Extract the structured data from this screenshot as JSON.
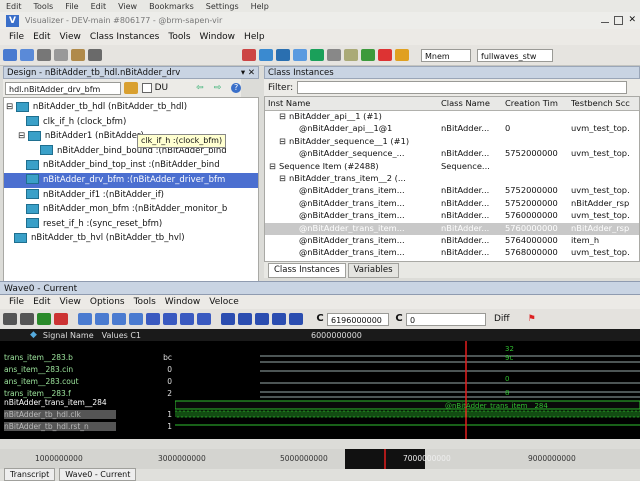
{
  "top_menu": [
    "Edit",
    "Tools",
    "File",
    "Edit",
    "View",
    "Bookmarks",
    "Settings",
    "Help"
  ],
  "window_title": "Visualizer - DEV-main #806177 - @brm-sapen-vir",
  "app_menu": [
    "File",
    "Edit",
    "View",
    "Class Instances",
    "Tools",
    "Window",
    "Help"
  ],
  "toolbar": {
    "mnem_select": "Mnem",
    "waves_select": "fullwaves_stw"
  },
  "design_panel": {
    "title": "Design - nBitAdder_tb_hdl.nBitAdder_drv",
    "scope_select": "hdl.nBitAdder_drv_bfm",
    "du_label": "DU",
    "tree": [
      {
        "label": "nBitAdder_tb_hdl (nBitAdder_tb_hdl)",
        "indent": 0,
        "selected": false
      },
      {
        "label": "clk_if_h (clock_bfm)",
        "indent": 1,
        "selected": false
      },
      {
        "label": "nBitAdder1 (nBitAdder)",
        "indent": 1,
        "selected": false
      },
      {
        "label": "nBitAdder_bind_bound :(nBitAdder_bind",
        "indent": 2,
        "selected": false
      },
      {
        "label": "nBitAdder_bind_top_inst :(nBitAdder_bind",
        "indent": 1,
        "selected": false
      },
      {
        "label": "nBitAdder_drv_bfm :(nBitAdder_driver_bfm",
        "indent": 1,
        "selected": true
      },
      {
        "label": "nBitAdder_if1 :(nBitAdder_if)",
        "indent": 1,
        "selected": false
      },
      {
        "label": "nBitAdder_mon_bfm :(nBitAdder_monitor_b",
        "indent": 1,
        "selected": false
      },
      {
        "label": "reset_if_h :(sync_reset_bfm)",
        "indent": 1,
        "selected": false
      },
      {
        "label": "nBitAdder_tb_hvl (nBitAdder_tb_hvl)",
        "indent": 0,
        "selected": false
      }
    ],
    "tooltip": "clk_if_h :(clock_bfm)"
  },
  "class_panel": {
    "title": "Class Instances",
    "filter_label": "Filter:",
    "columns": [
      "Inst Name",
      "Class Name",
      "Creation Tim",
      "Testbench Scc"
    ],
    "rows": [
      {
        "name": "nBitAdder_api__1 (#1)",
        "cls": "",
        "time": "",
        "scope": "",
        "indent": 1,
        "sel": false
      },
      {
        "name": "@nBitAdder_api__1@1",
        "cls": "nBitAdder...",
        "time": "0",
        "scope": "uvm_test_top.",
        "indent": 2,
        "sel": false
      },
      {
        "name": "nBitAdder_sequence__1 (#1)",
        "cls": "",
        "time": "",
        "scope": "",
        "indent": 1,
        "sel": false
      },
      {
        "name": "@nBitAdder_sequence_...",
        "cls": "nBitAdder...",
        "time": "5752000000",
        "scope": "uvm_test_top.",
        "indent": 2,
        "sel": false
      },
      {
        "name": "Sequence Item (#2488)",
        "cls": "Sequence...",
        "time": "",
        "scope": "",
        "indent": 0,
        "sel": false
      },
      {
        "name": "nBitAdder_trans_item__2 (...",
        "cls": "",
        "time": "",
        "scope": "",
        "indent": 1,
        "sel": false
      },
      {
        "name": "@nBitAdder_trans_item...",
        "cls": "nBitAdder...",
        "time": "5752000000",
        "scope": "uvm_test_top.",
        "indent": 2,
        "sel": false
      },
      {
        "name": "@nBitAdder_trans_item...",
        "cls": "nBitAdder...",
        "time": "5752000000",
        "scope": "nBitAdder_rsp",
        "indent": 2,
        "sel": false
      },
      {
        "name": "@nBitAdder_trans_item...",
        "cls": "nBitAdder...",
        "time": "5760000000",
        "scope": "uvm_test_top.",
        "indent": 2,
        "sel": false
      },
      {
        "name": "@nBitAdder_trans_item...",
        "cls": "nBitAdder...",
        "time": "5760000000",
        "scope": "nBitAdder_rsp",
        "indent": 2,
        "sel": true
      },
      {
        "name": "@nBitAdder_trans_item...",
        "cls": "nBitAdder...",
        "time": "5764000000",
        "scope": "item_h",
        "indent": 2,
        "sel": false
      },
      {
        "name": "@nBitAdder_trans_item...",
        "cls": "nBitAdder...",
        "time": "5768000000",
        "scope": "uvm_test_top.",
        "indent": 2,
        "sel": false
      }
    ],
    "tabs": [
      "Class Instances",
      "Variables"
    ]
  },
  "wave": {
    "title": "Wave0 - Current",
    "menu": [
      "File",
      "Edit",
      "View",
      "Options",
      "Tools",
      "Window",
      "Veloce"
    ],
    "time_field": "6196000000",
    "cursor_field": "0",
    "diff_label": "Diff",
    "col_signal": "Signal Name",
    "col_values": "Values C1",
    "ruler_top": "6000000000",
    "signals": [
      {
        "name": "trans_item__283.b",
        "value": "bc"
      },
      {
        "name": "ans_item__283.cin",
        "value": "0"
      },
      {
        "name": "ans_item__283.cout",
        "value": "0"
      },
      {
        "name": "trans_item__283.f",
        "value": "2"
      },
      {
        "name": "nBitAdder_trans_item__284",
        "value": ""
      },
      {
        "name": "nBitAdder_tb_hdl.clk",
        "value": "1"
      },
      {
        "name": "nBitAdder_tb_hdl.rst_n",
        "value": "1"
      }
    ],
    "wave_values": [
      "32",
      "9c",
      "0",
      "8"
    ],
    "transaction_label": "@nBitAdder_trans_item__284",
    "timeline_labels": [
      "1000000000",
      "3000000000",
      "5000000000",
      "7000000000",
      "9000000000"
    ],
    "bottom_tabs": [
      "Transcript",
      "Wave0 - Current"
    ]
  },
  "colors": {
    "accent": "#4b6fd0",
    "wave_green": "#2fbf2f",
    "cursor_red": "#e21d1d"
  }
}
